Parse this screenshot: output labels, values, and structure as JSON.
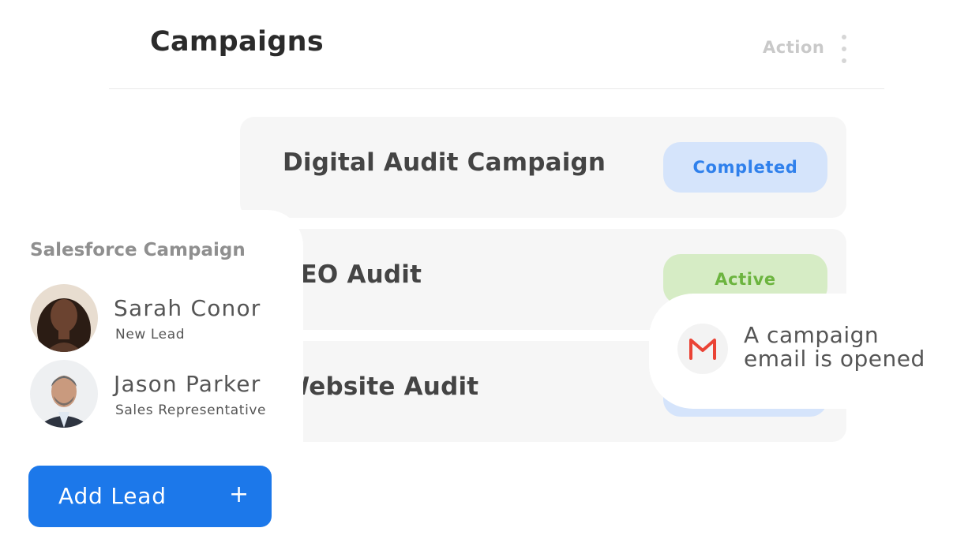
{
  "header": {
    "title": "Campaigns",
    "action_label": "Action"
  },
  "campaigns": [
    {
      "name": "Digital Audit Campaign",
      "status": "Completed",
      "status_color": "#2f80ec"
    },
    {
      "name": "SEO Audit",
      "status": "Active",
      "status_color": "#6cb43f"
    },
    {
      "name": "Website Audit",
      "status": "",
      "status_color": "#2f80ec"
    }
  ],
  "salesforce": {
    "title": "Salesforce Campaign",
    "leads": [
      {
        "name": "Sarah Conor",
        "role": "New Lead"
      },
      {
        "name": "Jason Parker",
        "role": "Sales Representative"
      }
    ]
  },
  "add_lead": {
    "label": "Add Lead",
    "icon": "+"
  },
  "notification": {
    "icon": "gmail-icon",
    "text": "A campaign email is opened"
  },
  "colors": {
    "primary": "#1c78ea",
    "completed_bg": "#d5e4fb",
    "active_bg": "#d6ecc5",
    "gmail_red": "#ea4335"
  }
}
